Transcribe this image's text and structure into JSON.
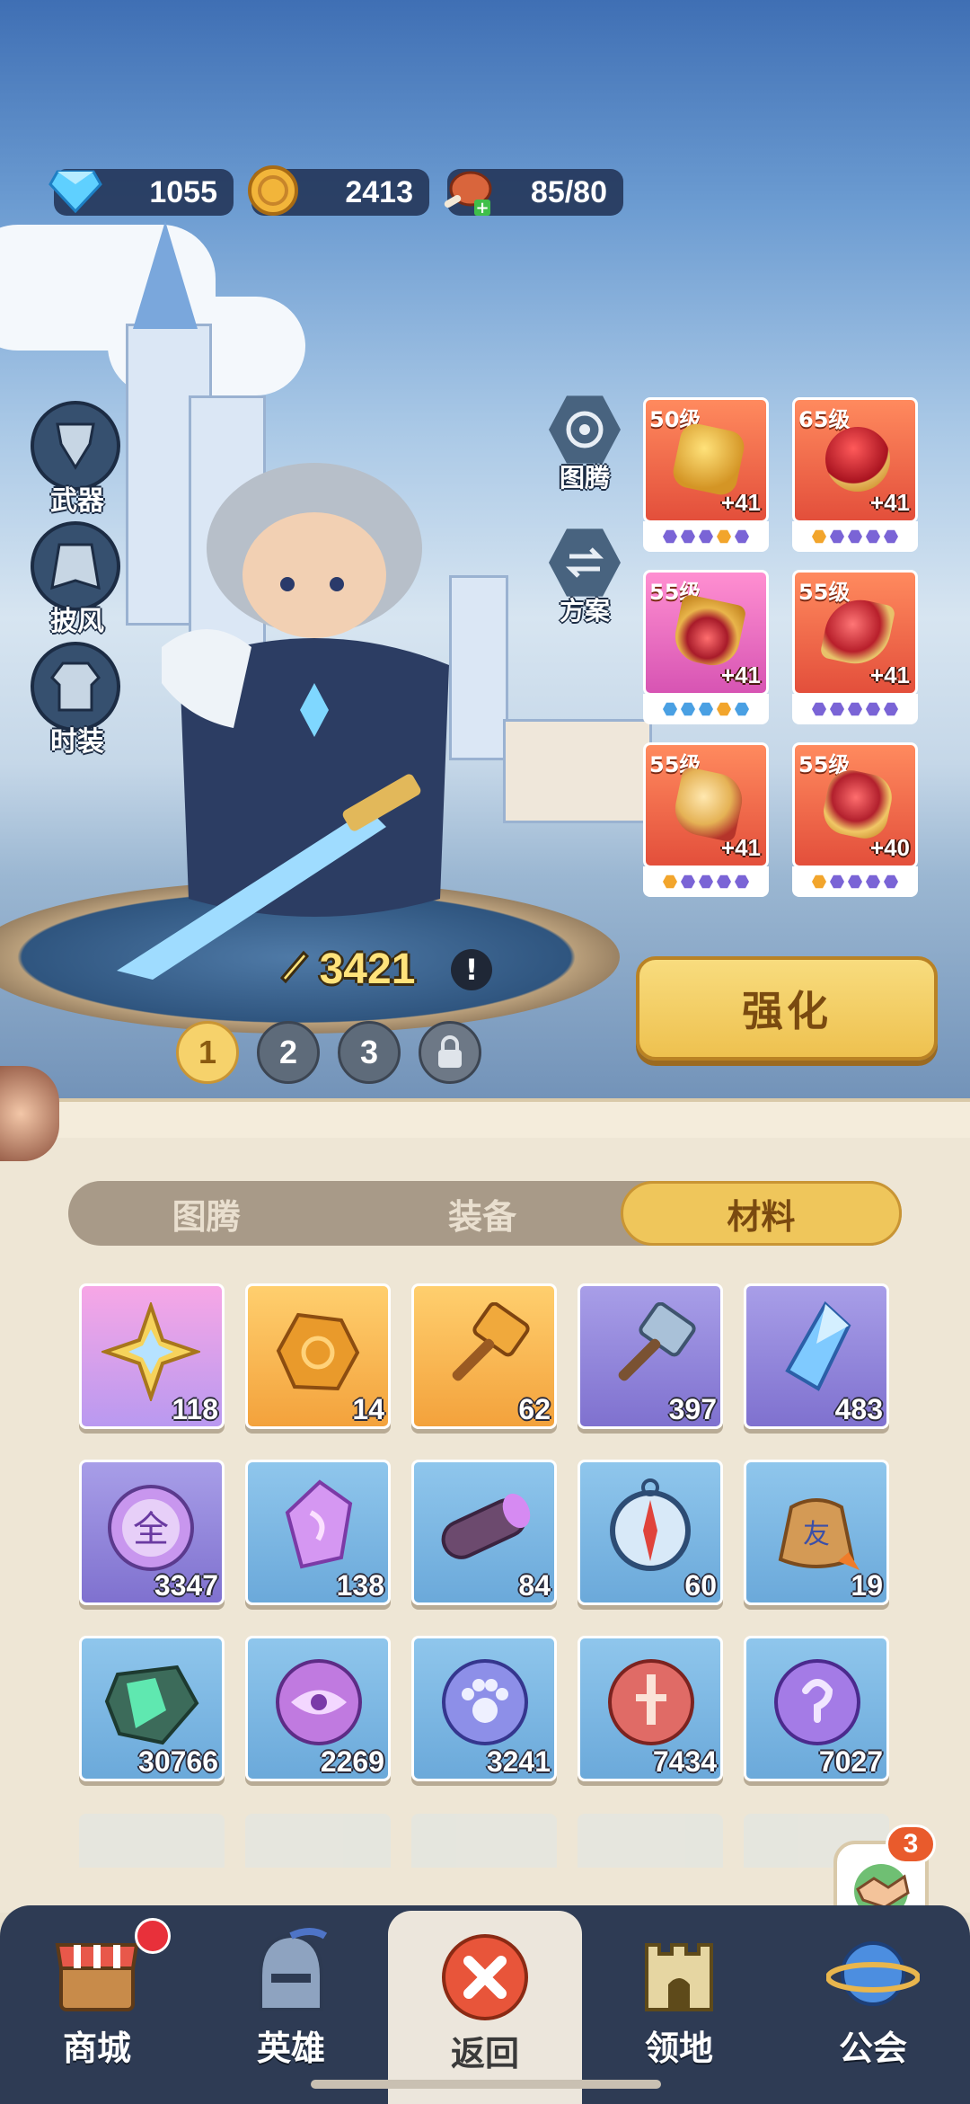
{
  "resources": {
    "diamond": "1055",
    "gold": "2413",
    "stamina": "85/80"
  },
  "side_buttons": [
    "武器",
    "披风",
    "时装"
  ],
  "hex_buttons": [
    "图腾",
    "方案"
  ],
  "equipment": [
    {
      "level": "50级",
      "plus": "+41",
      "style": "orange"
    },
    {
      "level": "65级",
      "plus": "+41",
      "style": "orange"
    },
    {
      "level": "55级",
      "plus": "+41",
      "style": "pink"
    },
    {
      "level": "55级",
      "plus": "+41",
      "style": "orange"
    },
    {
      "level": "55级",
      "plus": "+41",
      "style": "orange"
    },
    {
      "level": "55级",
      "plus": "+40",
      "style": "orange"
    }
  ],
  "power": "3421",
  "loadout_slots": [
    "1",
    "2",
    "3"
  ],
  "strengthen_button": "强化",
  "tabs": [
    {
      "label": "图腾",
      "active": false
    },
    {
      "label": "装备",
      "active": false
    },
    {
      "label": "材料",
      "active": true
    }
  ],
  "materials": [
    {
      "count": "118",
      "color": "gold"
    },
    {
      "count": "14",
      "color": "orange"
    },
    {
      "count": "62",
      "color": "orange"
    },
    {
      "count": "397",
      "color": "purple"
    },
    {
      "count": "483",
      "color": "purple"
    },
    {
      "count": "3347",
      "color": "purple",
      "glyph": "全"
    },
    {
      "count": "138",
      "color": "blue"
    },
    {
      "count": "84",
      "color": "blue"
    },
    {
      "count": "60",
      "color": "blue"
    },
    {
      "count": "19",
      "color": "blue",
      "glyph": "友"
    },
    {
      "count": "30766",
      "color": "blue"
    },
    {
      "count": "2269",
      "color": "blue"
    },
    {
      "count": "3241",
      "color": "blue"
    },
    {
      "count": "7434",
      "color": "blue"
    },
    {
      "count": "7027",
      "color": "blue"
    }
  ],
  "social_badge": "3",
  "nav": [
    {
      "label": "商城",
      "icon": "shop-icon"
    },
    {
      "label": "英雄",
      "icon": "helmet-icon"
    },
    {
      "label": "返回",
      "icon": "close-icon"
    },
    {
      "label": "领地",
      "icon": "castle-icon"
    },
    {
      "label": "公会",
      "icon": "planet-icon"
    }
  ],
  "colors": {
    "accent": "#efc65b",
    "nav_bg": "#2e3b54",
    "panel_bg": "#eee6d5",
    "close_red": "#e8553a"
  }
}
